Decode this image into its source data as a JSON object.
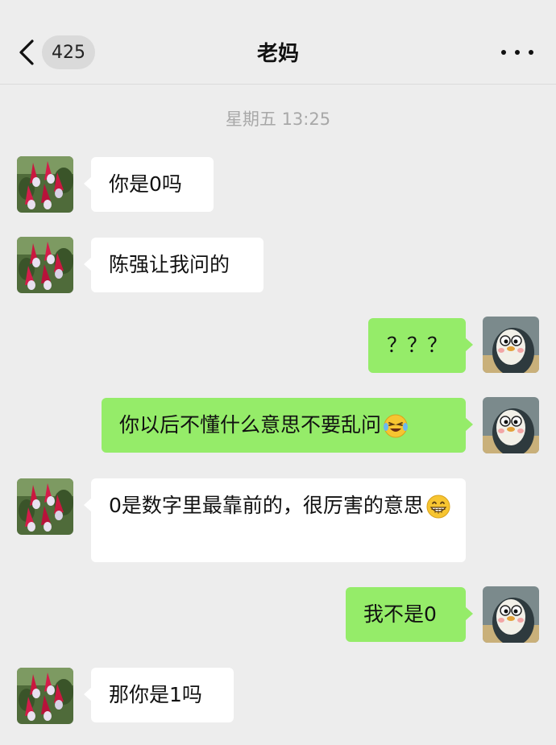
{
  "header": {
    "back_icon": "chevron-left-icon",
    "unread_count": "425",
    "title": "老妈",
    "more_icon": "more-dots-icon"
  },
  "timestamp": "星期五 13:25",
  "messages": [
    {
      "side": "in",
      "text": "你是0吗"
    },
    {
      "side": "in",
      "text": "陈强让我问的"
    },
    {
      "side": "out",
      "text": "？？？"
    },
    {
      "side": "out",
      "text": "你以后不懂什么意思不要乱问",
      "emoji": "laughing-crying-emoji"
    },
    {
      "side": "in",
      "text": "0是数字里最靠前的，很厉害的意思",
      "emoji": "grinning-emoji"
    },
    {
      "side": "out",
      "text": "我不是0"
    },
    {
      "side": "in",
      "text": "那你是1吗"
    }
  ],
  "colors": {
    "background": "#ededed",
    "incoming_bubble": "#ffffff",
    "outgoing_bubble": "#95ec69",
    "timestamp": "#a8a8a8"
  }
}
